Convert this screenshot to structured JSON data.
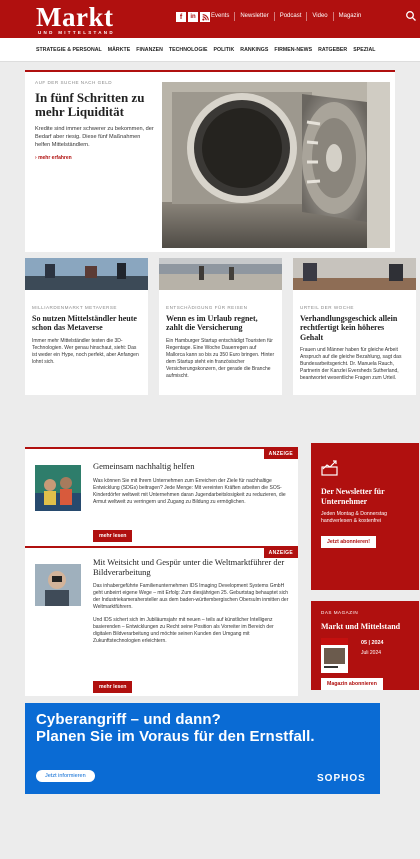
{
  "brand": {
    "name": "Markt",
    "tagline": "UND MITTELSTAND"
  },
  "social": [
    "f",
    "in",
    "rss"
  ],
  "top_links": [
    "Events",
    "Newsletter",
    "Podcast",
    "Video",
    "Magazin"
  ],
  "nav": [
    "STRATEGIE & PERSONAL",
    "MÄRKTE",
    "FINANZEN",
    "TECHNOLOGIE",
    "POLITIK",
    "RANKINGS",
    "FIRMEN-NEWS",
    "RATGEBER",
    "SPEZIAL"
  ],
  "feature": {
    "kicker": "AUF DER SUCHE NACH GELD",
    "title": "In fünf Schritten zu mehr Liquidität",
    "desc": "Kredite sind immer schwerer zu bekommen, der Bedarf aber riesig. Diese fünf Maßnahmen helfen Mittelständlern.",
    "more": "mehr erfahren"
  },
  "cards": [
    {
      "kicker": "MILLIARDENMARKT METAVERSE",
      "title": "So nutzen Mittelständler heute schon das Metaverse",
      "desc": "Immer mehr Mittelständler testen die 3D-Technologien. Wer genau hinschaut, sieht: Das ist weder ein Hype, noch perfekt, aber Anfangen lohnt sich."
    },
    {
      "kicker": "ENTSCHÄDIGUNG FÜR REISEN",
      "title": "Wenn es im Urlaub regnet, zahlt die Versicherung",
      "desc": "Ein Hamburger Startup entschädigt Touristen für Regentage. Eine Woche Dauerregen auf Mallorca kann so bis zu 350 Euro bringen. Hinter dem Startup steht ein französischer Versicherungskonzern, der gerade die Branche aufmischt."
    },
    {
      "kicker": "URTEIL DER WOCHE",
      "title": "Verhandlungsgeschick allein rechtfertigt kein höheres Gehalt",
      "desc": "Frauen und Männer haben für gleiche Arbeit Anspruch auf die gleiche Bezahlung, sagt das Bundesarbeitsgericht. Dr. Manuela Rauch, Partnerin der Kanzlei Eversheds Sutherland, beantwortet wesentliche Fragen zum Urteil."
    }
  ],
  "ads": [
    {
      "badge": "ANZEIGE",
      "title": "Gemeinsam nachhaltig helfen",
      "desc": "Was können Sie mit Ihrem Unternehmen zum Erreichen der Ziele für nachhaltige Entwicklung (SDGs) beitragen? Jede Menge: Mit vereinten Kräften arbeiten die SOS-Kinderdörfer weltweit mit Unternehmen daran Jugendarbeitslosigkeit zu reduzieren, die Armut weltweit zu verringern und Zugang zu Bildung zu ermöglichen.",
      "button": "mehr lesen"
    },
    {
      "badge": "ANZEIGE",
      "title": "Mit Weitsicht und Gespür unter die Weltmarktführer der Bildverarbeitung",
      "desc": "Das inhabergeführte Familienunternehmen IDS Imaging Development Systems GmbH geht unbeirrt eigene Wege – mit Erfolg: Zum diesjährigen 25. Geburtstag behauptet sich der Industriekamerahersteller aus dem baden-württembergischen Obersulm inmitten der Weltmarktführern.",
      "desc2": "Und IDS sichert sich im Jubiläumsjahr mit neuen – teils auf künstlicher Intelligenz basierenden – Entwicklungen zu Recht seine Position als Vorreiter im Bereich der digitalen Bildverarbeitung und möchte seinen Kunden den Umgang mit Zukunftstechnologien erleichtern.",
      "button": "mehr lesen"
    }
  ],
  "newsletter": {
    "title": "Der Newsletter für Unternehmer",
    "desc": "Jeden Montag & Donnerstag handverlesen & kostenfrei",
    "button": "Jetzt abonnieren!"
  },
  "magazine": {
    "label": "DAS MAGAZIN",
    "title": "Markt und Mittelstand",
    "issue": "05 | 2024",
    "date": "Juli 2024",
    "button": "Magazin abonnieren"
  },
  "banner": {
    "line1": "Cyberangriff – und dann?",
    "line2": "Planen Sie im Voraus für den Ernstfall.",
    "button": "Jetzt informieren",
    "logo": "SOPHOS"
  }
}
